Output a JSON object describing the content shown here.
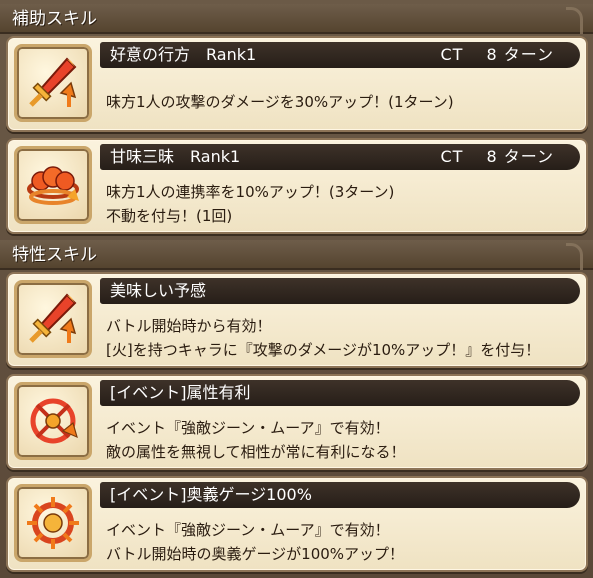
{
  "sections": {
    "support": {
      "title": "補助スキル"
    },
    "trait": {
      "title": "特性スキル"
    }
  },
  "support_skills": [
    {
      "name": "好意の行方　Rank1",
      "ct": "CT　 8 ターン",
      "lines": [
        "味方1人の攻撃のダメージを30%アップ！(1ターン)"
      ],
      "icon": "sword-up-icon"
    },
    {
      "name": "甘味三昧　Rank1",
      "ct": "CT　 8 ターン",
      "lines": [
        "味方1人の連携率を10%アップ！(3ターン)",
        "不動を付与！(1回)"
      ],
      "icon": "link-up-icon"
    }
  ],
  "trait_skills": [
    {
      "name": "美味しい予感",
      "lines": [
        "バトル開始時から有効！",
        "[火]を持つキャラに『攻撃のダメージが10%アップ！』を付与！"
      ],
      "icon": "sword-up-icon"
    },
    {
      "name": "[イベント]属性有利",
      "lines": [
        "イベント『強敵ジーン・ムーア』で有効！",
        "敵の属性を無視して相性が常に有利になる！"
      ],
      "icon": "element-advantage-icon"
    },
    {
      "name": "[イベント]奥義ゲージ100%",
      "lines": [
        "イベント『強敵ジーン・ムーア』で有効！",
        "バトル開始時の奥義ゲージが100%アップ！"
      ],
      "icon": "gauge-burst-icon"
    }
  ]
}
